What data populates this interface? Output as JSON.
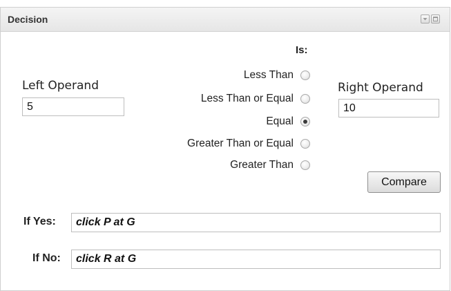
{
  "panel": {
    "title": "Decision",
    "header_icons": [
      "collapse-icon",
      "maximize-icon"
    ]
  },
  "left_operand": {
    "label": "Left Operand",
    "value": "5"
  },
  "right_operand": {
    "label": "Right Operand",
    "value": "10"
  },
  "operator": {
    "heading": "Is:",
    "options": [
      {
        "label": "Less Than",
        "checked": false
      },
      {
        "label": "Less Than or Equal",
        "checked": false
      },
      {
        "label": "Equal",
        "checked": true
      },
      {
        "label": "Greater Than or Equal",
        "checked": false
      },
      {
        "label": "Greater Than",
        "checked": false
      }
    ]
  },
  "compare_button": {
    "label": "Compare"
  },
  "if_yes": {
    "label": "If Yes:",
    "value": "click P at G"
  },
  "if_no": {
    "label": "If No:",
    "value": "click R at G"
  },
  "colors": {
    "header_bg": "#e9e9e9",
    "border": "#cfcfcf",
    "radio_selected": "#3c3c3c"
  }
}
